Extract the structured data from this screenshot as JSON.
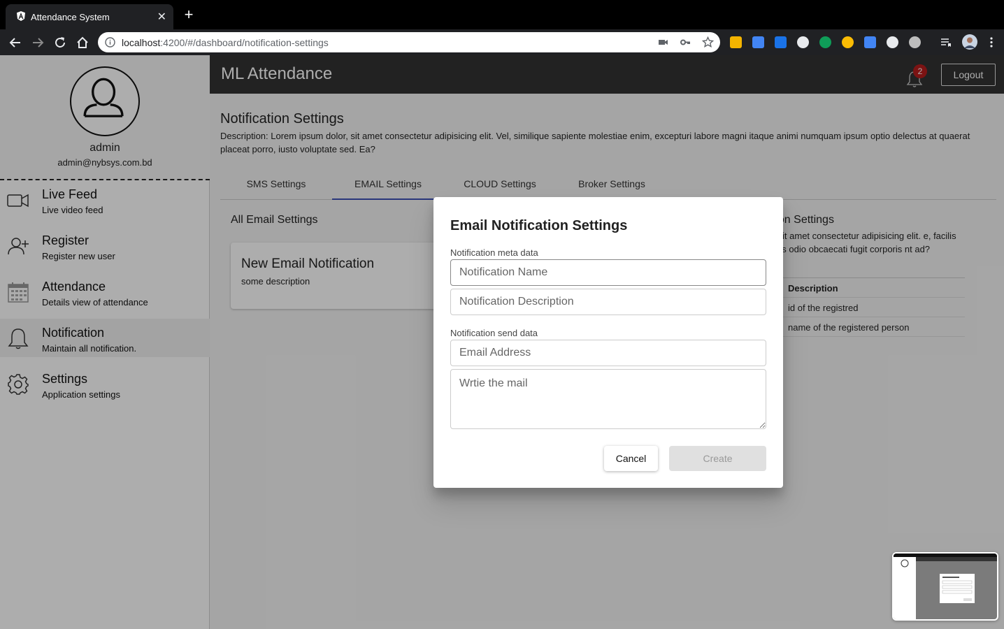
{
  "browser": {
    "tab_title": "Attendance System",
    "tab_close": "✕",
    "new_tab": "+",
    "url_host": "localhost",
    "url_path": ":4200/#/dashboard/notification-settings",
    "extension_colors": [
      "#f4b400",
      "#4285f4",
      "#1a73e8",
      "#e8eaed",
      "#0f9d58",
      "#fbbc04",
      "#4285f4",
      "#e8eaed",
      "#bdbdbd"
    ]
  },
  "sidebar": {
    "username": "admin",
    "email": "admin@nybsys.com.bd",
    "items": [
      {
        "title": "Live Feed",
        "subtitle": "Live video feed",
        "icon": "video-camera-icon"
      },
      {
        "title": "Register",
        "subtitle": "Register new user",
        "icon": "add-user-icon"
      },
      {
        "title": "Attendance",
        "subtitle": "Details view of attendance",
        "icon": "calendar-icon"
      },
      {
        "title": "Notification",
        "subtitle": "Maintain all notification.",
        "icon": "bell-icon",
        "active": true
      },
      {
        "title": "Settings",
        "subtitle": "Application settings",
        "icon": "gear-icon"
      }
    ]
  },
  "header": {
    "title": "ML Attendance",
    "notification_count": "2",
    "logout_label": "Logout"
  },
  "page": {
    "title": "Notification Settings",
    "description": "Description: Lorem ipsum dolor, sit amet consectetur adipisicing elit. Vel, similique sapiente molestiae enim, excepturi labore magni itaque animi numquam ipsum optio delectus at quaerat placeat porro, iusto voluptate sed. Ea?",
    "tabs": [
      "SMS Settings",
      "EMAIL Settings",
      "CLOUD Settings",
      "Broker Settings"
    ],
    "active_tab": "EMAIL Settings"
  },
  "email_list": {
    "heading": "All Email Settings",
    "card_title": "New Email Notification",
    "card_description": "some description"
  },
  "right_panel": {
    "title": "fication Settings",
    "description": "dolor sit amet consectetur adipisicing elit. e, facilis veritatis odio obcaecati fugit corporis nt ad?",
    "table_header": "Description",
    "rows": [
      "id of the registred",
      "name of the registered person"
    ]
  },
  "dialog": {
    "title": "Email Notification Settings",
    "meta_section": "Notification meta data",
    "name_placeholder": "Notification Name",
    "description_placeholder": "Notification Description",
    "send_section": "Notification send data",
    "email_placeholder": "Email Address",
    "mail_placeholder": "Wrtie the mail",
    "cancel_label": "Cancel",
    "create_label": "Create"
  },
  "colors": {
    "appbar": "#333333",
    "active_tab_underline": "#3f51b5",
    "badge": "#b71c1c",
    "overlay": "rgba(0,0,0,0.32)"
  }
}
